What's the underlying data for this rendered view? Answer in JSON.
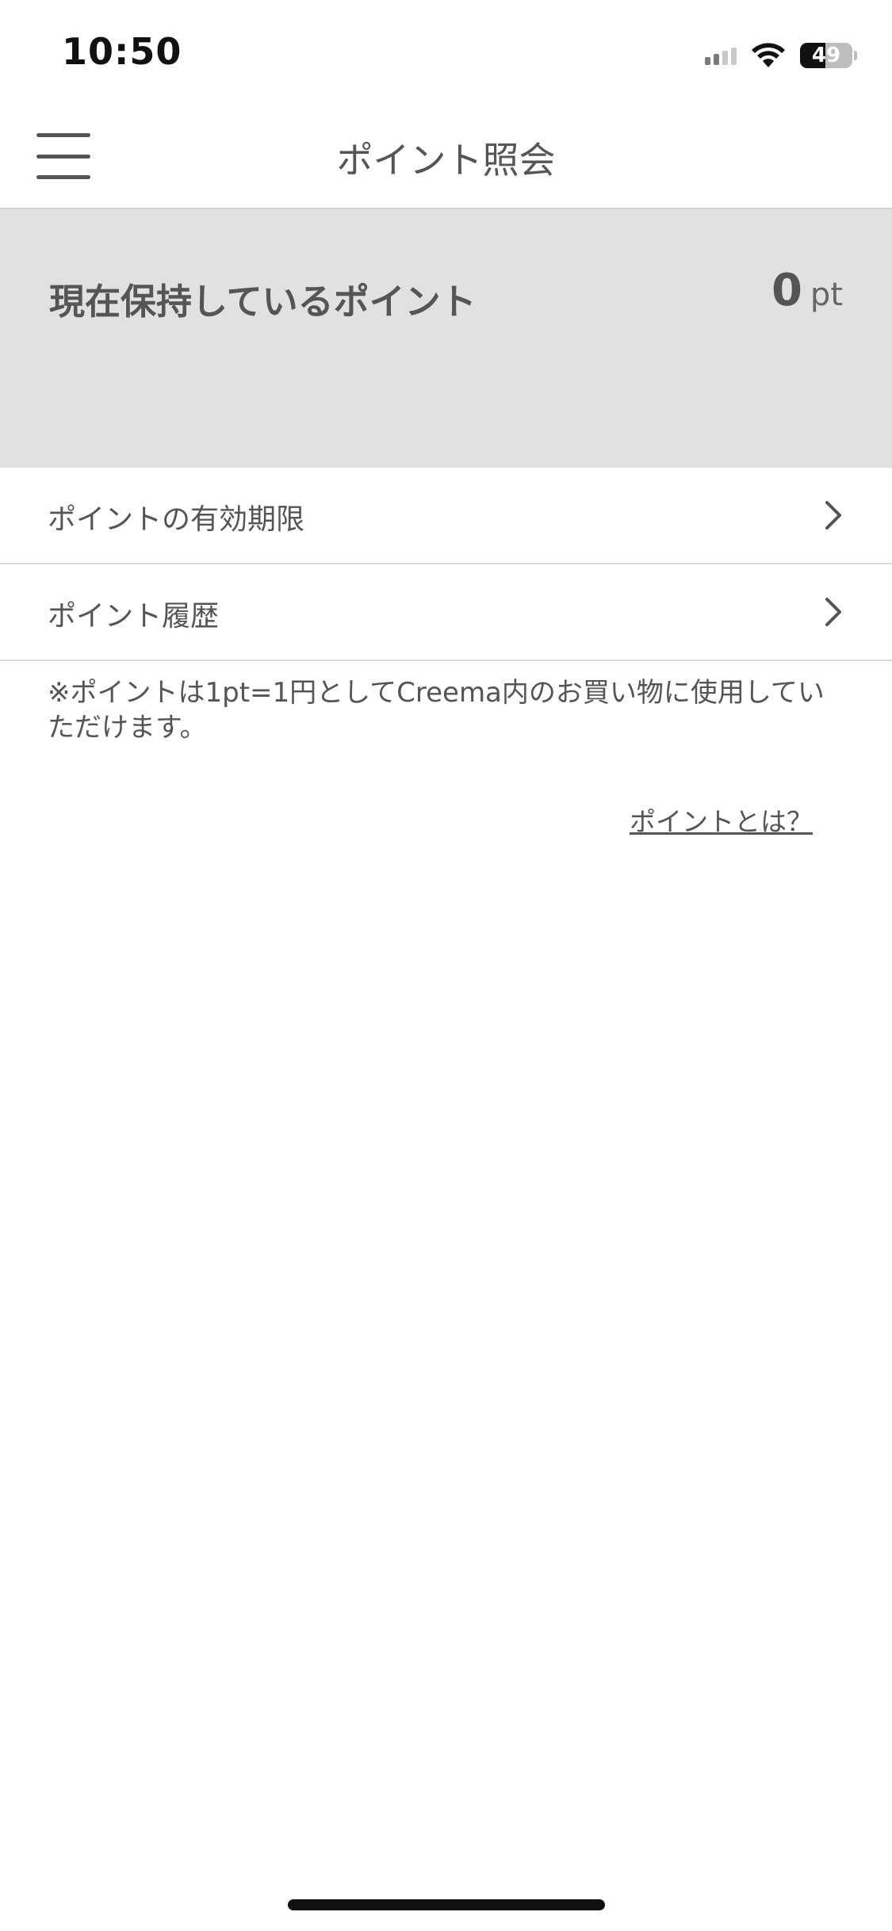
{
  "status_bar": {
    "time": "10:50",
    "battery_level": "49",
    "icons": [
      "cellular-signal-icon",
      "wifi-icon",
      "battery-icon"
    ]
  },
  "nav": {
    "title": "ポイント照会",
    "menu_icon": "hamburger-menu-icon"
  },
  "points": {
    "label": "現在保持しているポイント",
    "value": "0",
    "unit": "pt"
  },
  "list": {
    "items": [
      {
        "label": "ポイントの有効期限",
        "icon": "chevron-right-icon"
      },
      {
        "label": "ポイント履歴",
        "icon": "chevron-right-icon"
      }
    ]
  },
  "note": "※ポイントは1pt=1円としてCreema内のお買い物に使用していただけます。",
  "help_link": "ポイントとは？",
  "colors": {
    "text": "#555555",
    "panel_bg": "#e1e1e1",
    "divider": "#d9d9d9"
  }
}
